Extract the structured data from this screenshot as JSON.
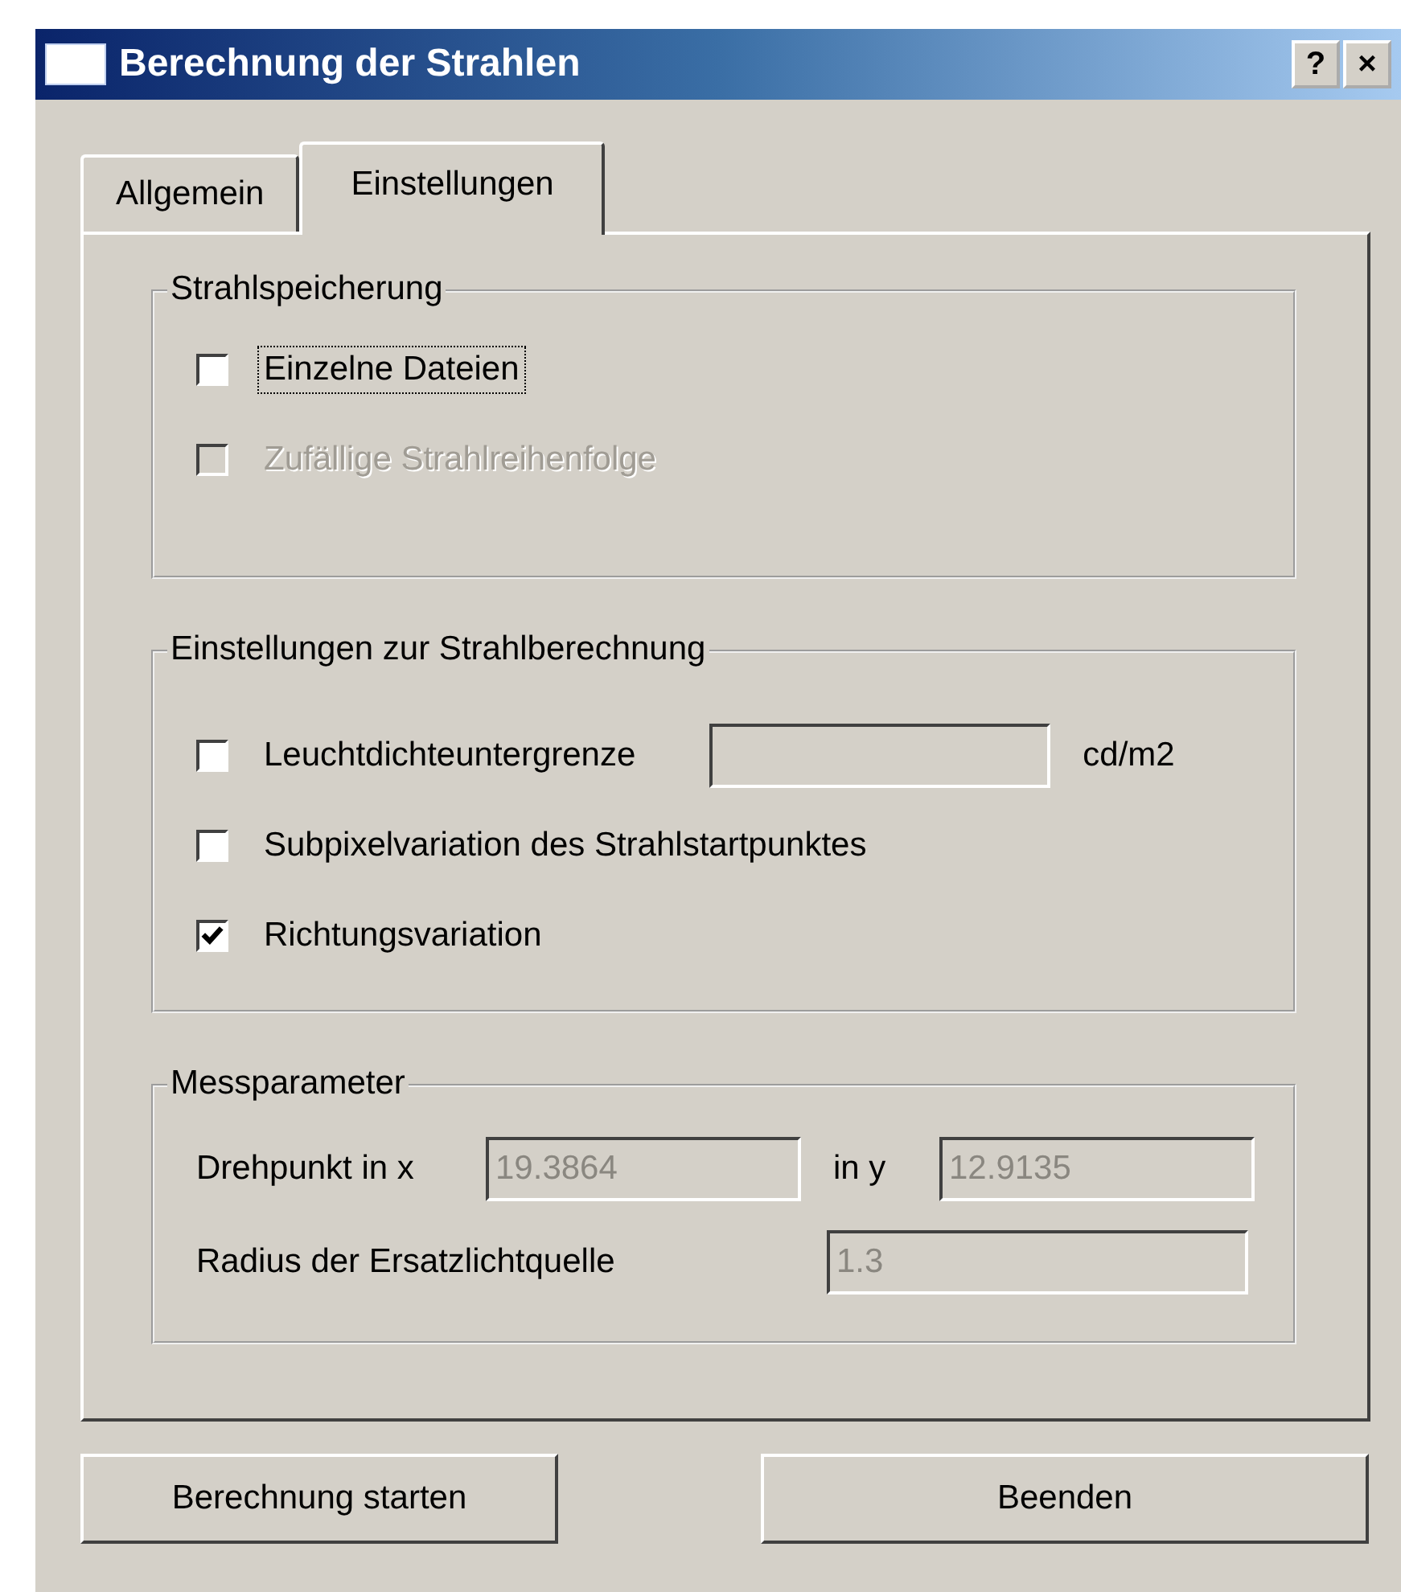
{
  "window": {
    "title": "Berechnung der Strahlen",
    "help_button": "?",
    "close_button": "×"
  },
  "tabs": [
    {
      "label": "Allgemein",
      "selected": false
    },
    {
      "label": "Einstellungen",
      "selected": true
    }
  ],
  "groups": [
    {
      "title": "Strahlspeicherung",
      "items": [
        {
          "kind": "checkbox",
          "label": "Einzelne Dateien",
          "checked": false,
          "disabled": false,
          "focused": true
        },
        {
          "kind": "checkbox",
          "label": "Zufällige Strahlreihenfolge",
          "checked": false,
          "disabled": true,
          "focused": false
        }
      ]
    },
    {
      "title": "Einstellungen zur Strahlberechnung",
      "items": [
        {
          "kind": "checkbox-field",
          "label": "Leuchtdichteuntergrenze",
          "checked": false,
          "disabled": false,
          "focused": false,
          "unit": "cd/m2"
        },
        {
          "kind": "checkbox",
          "label": "Subpixelvariation des Strahlstartpunktes",
          "checked": false,
          "disabled": false,
          "focused": false
        },
        {
          "kind": "checkbox",
          "label": "Richtungsvariation",
          "checked": true,
          "disabled": false,
          "focused": false
        }
      ]
    }
  ],
  "measurement": {
    "title": "Messparameter",
    "pivot_x_label": "Drehpunkt in x",
    "pivot_x_value": "19.3864",
    "pivot_y_label": "in y",
    "pivot_y_value": "12.9135",
    "radius_label": "Radius der Ersatzlichtquelle",
    "radius_value": "1.3"
  },
  "buttons": [
    "Berechnung starten",
    "Beenden"
  ]
}
